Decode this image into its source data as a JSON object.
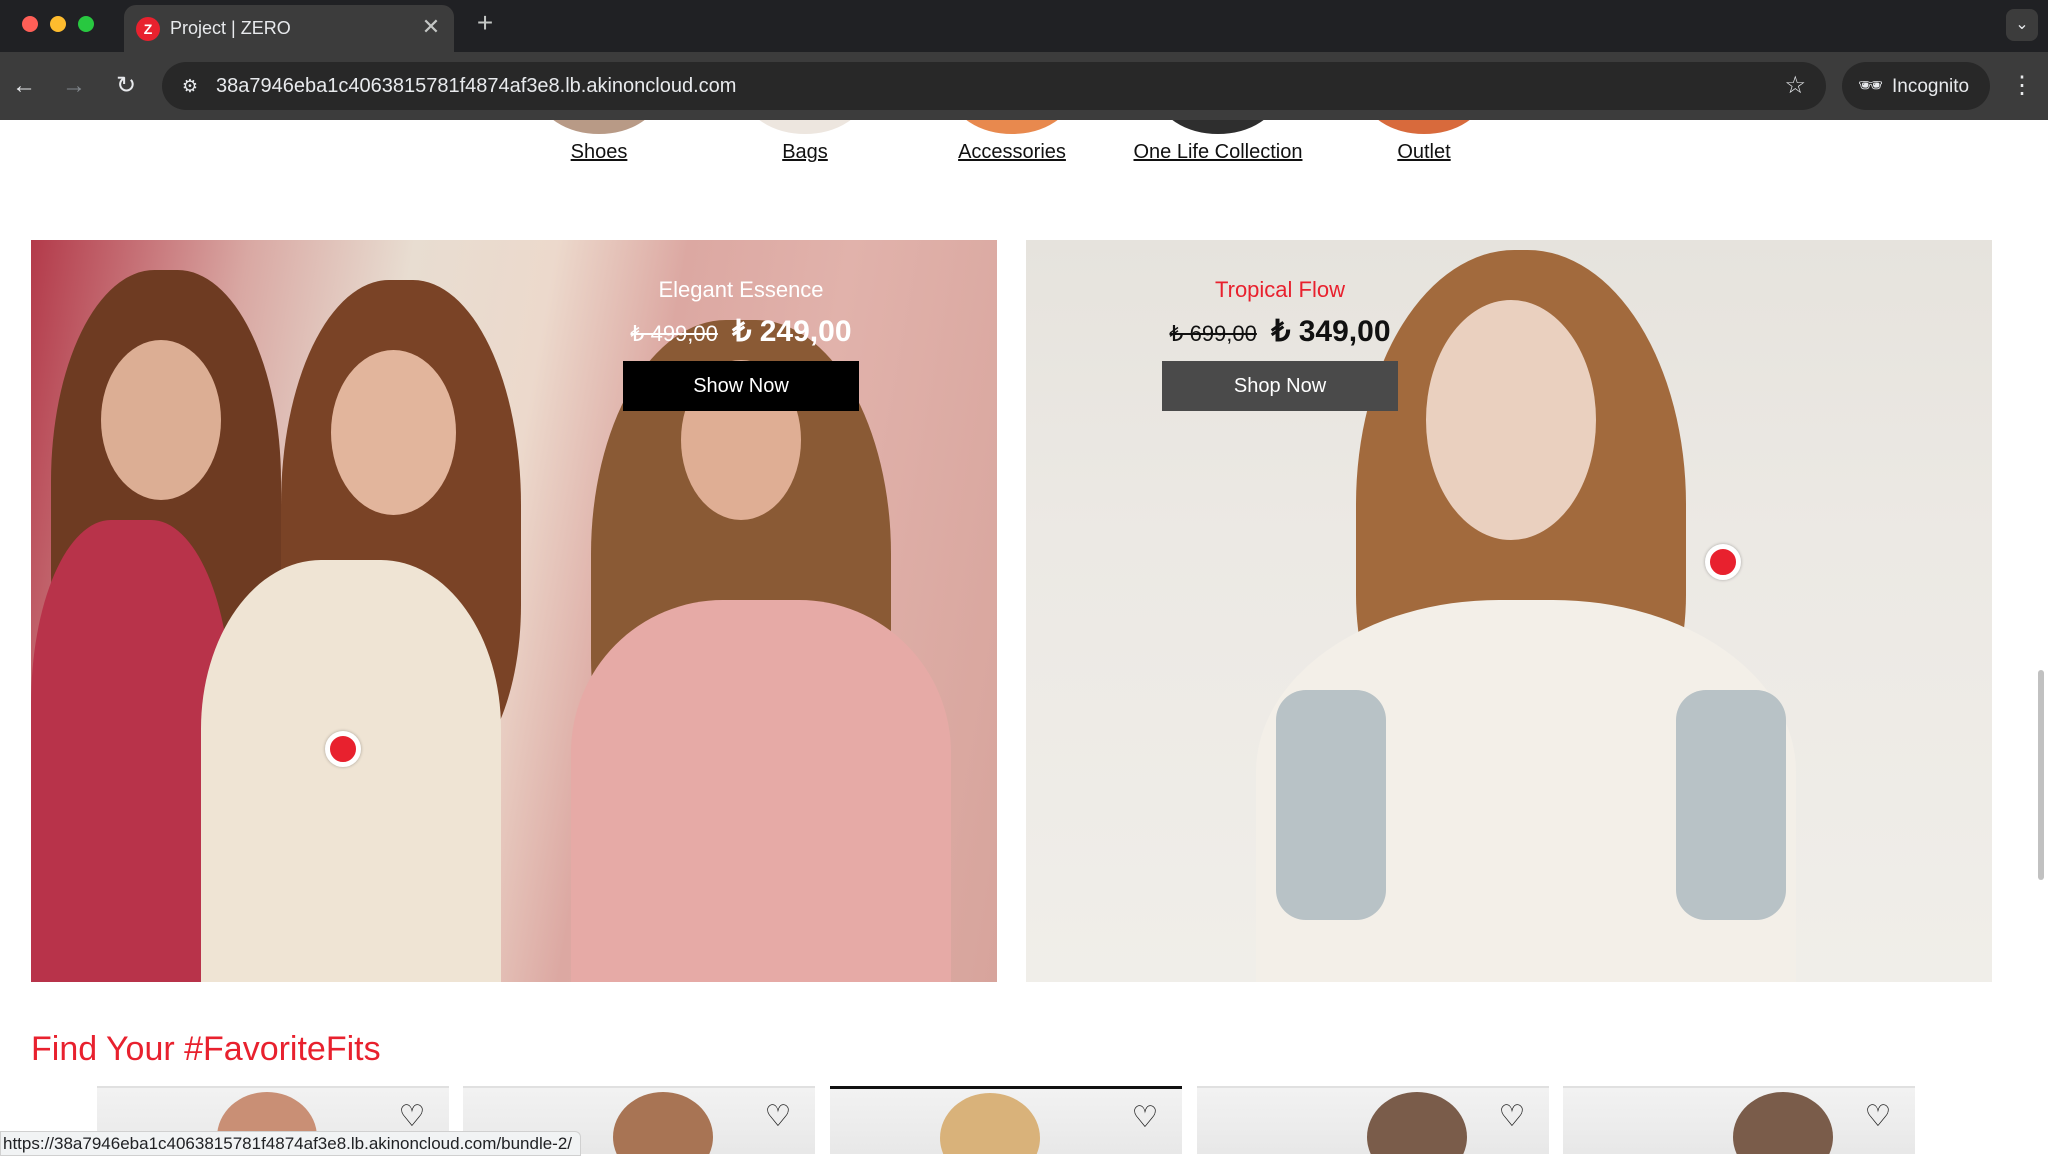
{
  "browser": {
    "tab": {
      "title": "Project | ZERO",
      "favicon_letter": "Z",
      "close_glyph": "✕"
    },
    "new_tab_glyph": "+",
    "tab_menu_glyph": "⌄",
    "nav": {
      "back": "←",
      "forward": "→",
      "reload": "↻"
    },
    "site_info_glyph": "⚙",
    "url": "38a7946eba1c4063815781f4874af3e8.lb.akinoncloud.com",
    "bookmark_glyph": "☆",
    "incognito": {
      "icon": "🕶",
      "label": "Incognito"
    },
    "menu_glyph": "⋮"
  },
  "categories": [
    {
      "label": "Shoes"
    },
    {
      "label": "Bags"
    },
    {
      "label": "Accessories"
    },
    {
      "label": "One Life Collection"
    },
    {
      "label": "Outlet"
    }
  ],
  "banners": [
    {
      "title": "Elegant Essence",
      "old_price": "₺ 499,00",
      "new_price": "₺ 249,00",
      "cta": "Show Now"
    },
    {
      "title": "Tropical Flow",
      "old_price": "₺ 699,00",
      "new_price": "₺ 349,00",
      "cta": "Shop Now"
    }
  ],
  "favorites": {
    "heading": "Find Your #FavoriteFits",
    "heart_glyph": "♡"
  },
  "status_bar": {
    "url": "https://38a7946eba1c4063815781f4874af3e8.lb.akinoncloud.com/bundle-2/"
  },
  "colors": {
    "accent": "#e8212e",
    "chrome_dark": "#202124",
    "chrome_toolbar": "#3c3c3c"
  },
  "icons": [
    "close-icon",
    "plus-icon",
    "chevron-down-icon",
    "back-arrow-icon",
    "forward-arrow-icon",
    "reload-icon",
    "site-info-icon",
    "star-icon",
    "incognito-icon",
    "kebab-menu-icon",
    "heart-icon"
  ]
}
